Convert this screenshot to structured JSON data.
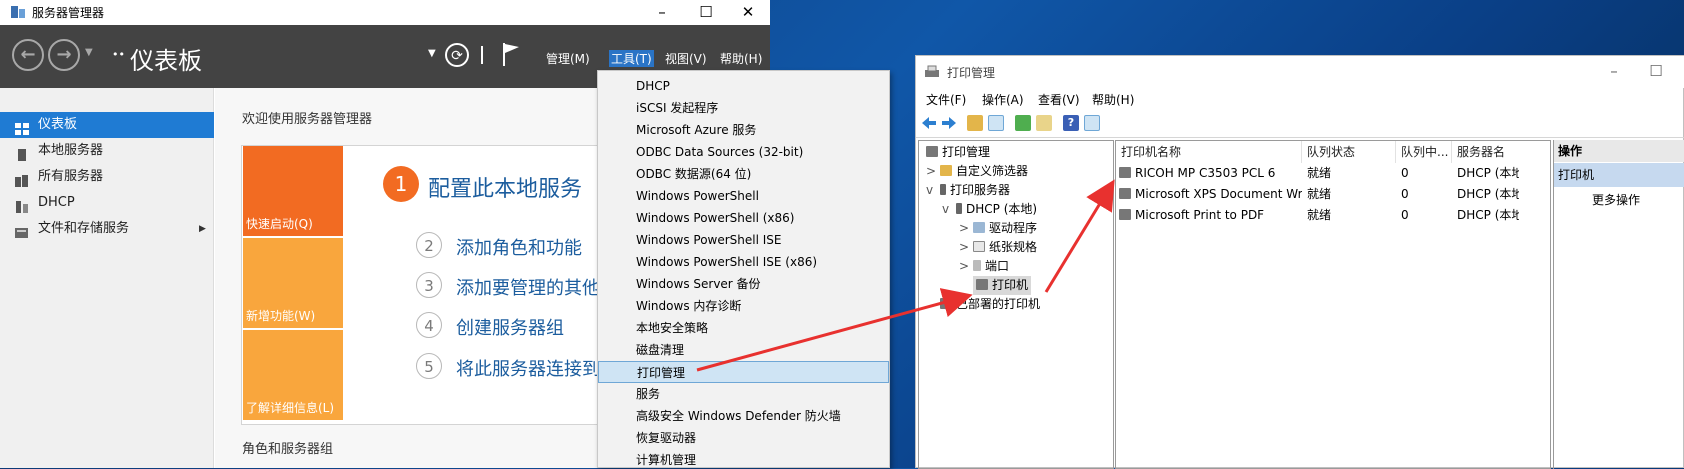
{
  "server_manager": {
    "window_title": "服务器管理器",
    "heading": "仪表板",
    "heading_prefix": "••",
    "toolbar_menus": [
      "管理(M)",
      "工具(T)",
      "视图(V)",
      "帮助(H)"
    ],
    "sidebar": [
      {
        "label": "仪表板",
        "selected": true
      },
      {
        "label": "本地服务器"
      },
      {
        "label": "所有服务器"
      },
      {
        "label": "DHCP"
      },
      {
        "label": "文件和存储服务"
      }
    ],
    "welcome_title": "欢迎使用服务器管理器",
    "tiles": [
      "快速启动(Q)",
      "新增功能(W)",
      "了解详细信息(L)"
    ],
    "steps": [
      {
        "num": "1",
        "text": "配置此本地服务"
      },
      {
        "num": "2",
        "text": "添加角色和功能"
      },
      {
        "num": "3",
        "text": "添加要管理的其他"
      },
      {
        "num": "4",
        "text": "创建服务器组"
      },
      {
        "num": "5",
        "text": "将此服务器连接到"
      }
    ],
    "section_title": "角色和服务器组"
  },
  "tools_menu": {
    "items": [
      "DHCP",
      "iSCSI 发起程序",
      "Microsoft Azure 服务",
      "ODBC Data Sources (32-bit)",
      "ODBC 数据源(64 位)",
      "Windows PowerShell",
      "Windows PowerShell (x86)",
      "Windows PowerShell ISE",
      "Windows PowerShell ISE (x86)",
      "Windows Server 备份",
      "Windows 内存诊断",
      "本地安全策略",
      "磁盘清理",
      "打印管理",
      "服务",
      "高级安全 Windows Defender 防火墙",
      "恢复驱动器",
      "计算机管理"
    ],
    "highlighted": "打印管理"
  },
  "print_management": {
    "window_title": "打印管理",
    "menus": [
      "文件(F)",
      "操作(A)",
      "查看(V)",
      "帮助(H)"
    ],
    "tree": [
      {
        "label": "打印管理",
        "level": 0
      },
      {
        "label": "自定义筛选器",
        "level": 1,
        "expander": ">"
      },
      {
        "label": "打印服务器",
        "level": 1,
        "expander": "v"
      },
      {
        "label": "DHCP (本地)",
        "level": 2,
        "expander": "v"
      },
      {
        "label": "驱动程序",
        "level": 3,
        "expander": ">"
      },
      {
        "label": "纸张规格",
        "level": 3,
        "expander": ">"
      },
      {
        "label": "端口",
        "level": 3,
        "expander": ">"
      },
      {
        "label": "打印机",
        "level": 3,
        "selected": true
      },
      {
        "label": "已部署的打印机",
        "level": 1
      }
    ],
    "columns": [
      "打印机名称",
      "队列状态",
      "队列中...",
      "服务器名"
    ],
    "rows": [
      [
        "RICOH MP C3503 PCL 6",
        "就绪",
        "0",
        "DHCP (本地)"
      ],
      [
        "Microsoft XPS Document Writer",
        "就绪",
        "0",
        "DHCP (本地)"
      ],
      [
        "Microsoft Print to PDF",
        "就绪",
        "0",
        "DHCP (本地)"
      ]
    ],
    "actions_title": "操作",
    "actions_selected": "打印机",
    "actions_more": "更多操作"
  },
  "colors": {
    "sm_toolbar": "#434343",
    "sidebar_selected": "#1f7bd3",
    "tile_orange": "#f26b22",
    "tile_light": "#f9a63d",
    "step_blue": "#1c5d9e",
    "arrow_red": "#e8312f"
  }
}
